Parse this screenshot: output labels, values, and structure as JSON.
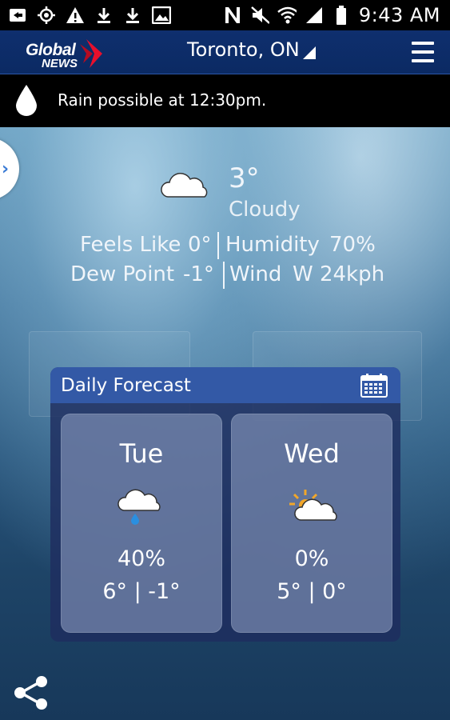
{
  "status_bar": {
    "time": "9:43 AM",
    "icons": [
      "media-icon",
      "gps-icon",
      "warning-icon",
      "download-icon",
      "download-icon",
      "image-icon",
      "nfc-icon",
      "mute-icon",
      "wifi-icon",
      "signal-icon",
      "battery-icon"
    ]
  },
  "app_bar": {
    "logo_line1": "Global",
    "logo_line2": "NEWS",
    "location": "Toronto, ON",
    "accent_color": "#0b2a63"
  },
  "alert": {
    "text": "Rain possible at 12:30pm."
  },
  "current": {
    "temperature": "3°",
    "condition": "Cloudy",
    "feels_like_label": "Feels Like",
    "feels_like_value": "0°",
    "humidity_label": "Humidity",
    "humidity_value": "70%",
    "dew_point_label": "Dew Point",
    "dew_point_value": "-1°",
    "wind_label": "Wind",
    "wind_value": "W 24kph"
  },
  "forecast": {
    "title": "Daily Forecast",
    "days": [
      {
        "day": "Tue",
        "icon": "cloud-rain-icon",
        "pop": "40%",
        "hilo": "6° | -1°"
      },
      {
        "day": "Wed",
        "icon": "partly-sunny-icon",
        "pop": "0%",
        "hilo": "5° | 0°"
      }
    ]
  }
}
